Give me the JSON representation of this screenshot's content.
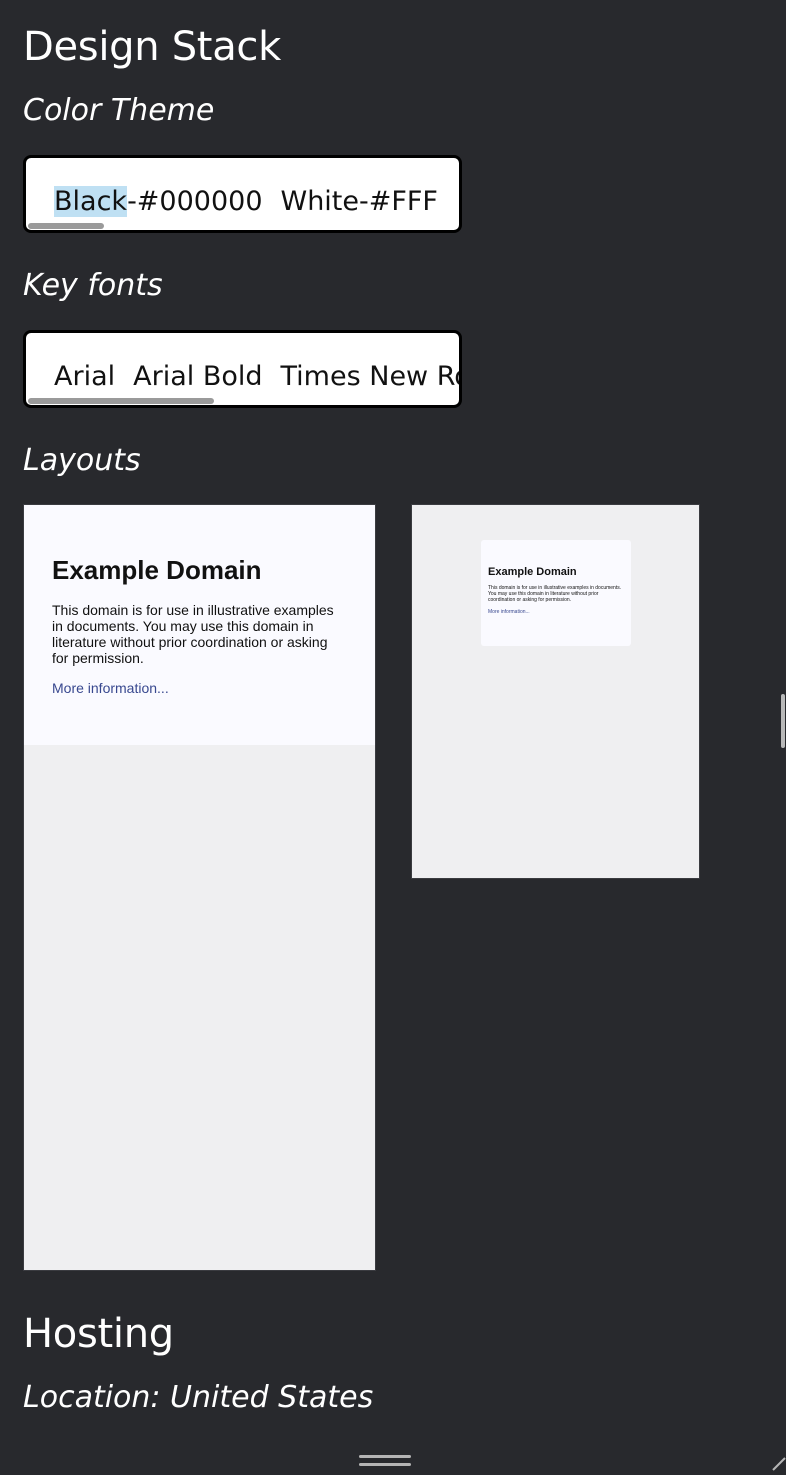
{
  "design_stack": {
    "title": "Design Stack",
    "color_theme": {
      "label": "Color Theme",
      "items": [
        "Black-#000000",
        "White-#FFF"
      ],
      "highlight_word": "Black"
    },
    "key_fonts": {
      "label": "Key fonts",
      "items": [
        "Arial",
        "Arial Bold",
        "Times New Ro"
      ]
    },
    "layouts": {
      "label": "Layouts",
      "previews": [
        {
          "title": "Example Domain",
          "body": "This domain is for use in illustrative examples in documents. You may use this domain in literature without prior coordination or asking for permission.",
          "link": "More information..."
        },
        {
          "title": "Example Domain",
          "body": "This domain is for use in illustrative examples in documents. You may use this domain in literature without prior coordination or asking for permission.",
          "link": "More information..."
        }
      ]
    }
  },
  "hosting": {
    "title": "Hosting",
    "location": "Location: United States"
  },
  "colors": {
    "background": "#28292d",
    "text": "#ffffff",
    "highlight": "#bfe0f3",
    "link": "#38488f"
  }
}
